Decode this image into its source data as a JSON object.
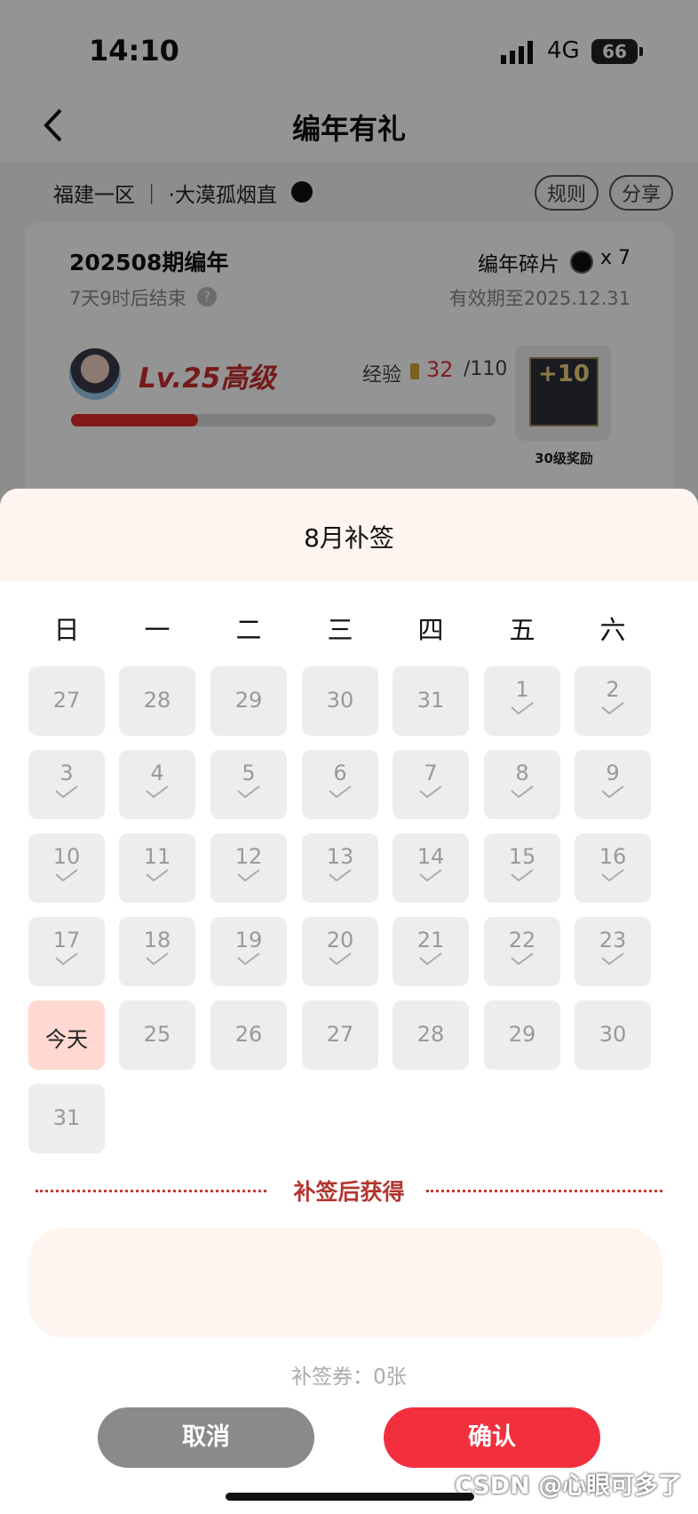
{
  "status_bar": {
    "time": "14:10",
    "network": "4G",
    "battery": "66"
  },
  "nav": {
    "title": "编年有礼"
  },
  "header": {
    "server": "福建一区 ｜ ·大漠孤烟直",
    "rule_label": "规则",
    "share_label": "分享"
  },
  "period": {
    "name": "202508期编年",
    "ends": "7天9时后结束",
    "fragment_label": "编年碎片",
    "fragment_count": "x 7",
    "expire": "有效期至2025.12.31"
  },
  "level": {
    "label": "Lv.25高级",
    "exp_label": "经验",
    "exp_current": "32",
    "exp_max": "/110",
    "progress": 0.3,
    "reward_badge": "+10",
    "reward_label": "30级奖励"
  },
  "sheet": {
    "title": "8月补签",
    "weekdays": [
      "日",
      "一",
      "二",
      "三",
      "四",
      "五",
      "六"
    ],
    "days": [
      {
        "label": "27",
        "checked": false
      },
      {
        "label": "28",
        "checked": false
      },
      {
        "label": "29",
        "checked": false
      },
      {
        "label": "30",
        "checked": false
      },
      {
        "label": "31",
        "checked": false
      },
      {
        "label": "1",
        "checked": true
      },
      {
        "label": "2",
        "checked": true
      },
      {
        "label": "3",
        "checked": true
      },
      {
        "label": "4",
        "checked": true
      },
      {
        "label": "5",
        "checked": true
      },
      {
        "label": "6",
        "checked": true
      },
      {
        "label": "7",
        "checked": true
      },
      {
        "label": "8",
        "checked": true
      },
      {
        "label": "9",
        "checked": true
      },
      {
        "label": "10",
        "checked": true
      },
      {
        "label": "11",
        "checked": true
      },
      {
        "label": "12",
        "checked": true
      },
      {
        "label": "13",
        "checked": true
      },
      {
        "label": "14",
        "checked": true
      },
      {
        "label": "15",
        "checked": true
      },
      {
        "label": "16",
        "checked": true
      },
      {
        "label": "17",
        "checked": true
      },
      {
        "label": "18",
        "checked": true
      },
      {
        "label": "19",
        "checked": true
      },
      {
        "label": "20",
        "checked": true
      },
      {
        "label": "21",
        "checked": true
      },
      {
        "label": "22",
        "checked": true
      },
      {
        "label": "23",
        "checked": true
      },
      {
        "label": "今天",
        "checked": false,
        "today": true
      },
      {
        "label": "25",
        "checked": false
      },
      {
        "label": "26",
        "checked": false
      },
      {
        "label": "27",
        "checked": false
      },
      {
        "label": "28",
        "checked": false
      },
      {
        "label": "29",
        "checked": false
      },
      {
        "label": "30",
        "checked": false
      },
      {
        "label": "31",
        "checked": false
      }
    ],
    "earn_label": "补签后获得",
    "ticket_text": "补签券：0张",
    "cancel_label": "取消",
    "confirm_label": "确认"
  },
  "watermark": "CSDN @心眼可多了",
  "colors": {
    "accent": "#f2303d",
    "earn": "#b4352f",
    "today_bg": "#ffd9d2"
  }
}
